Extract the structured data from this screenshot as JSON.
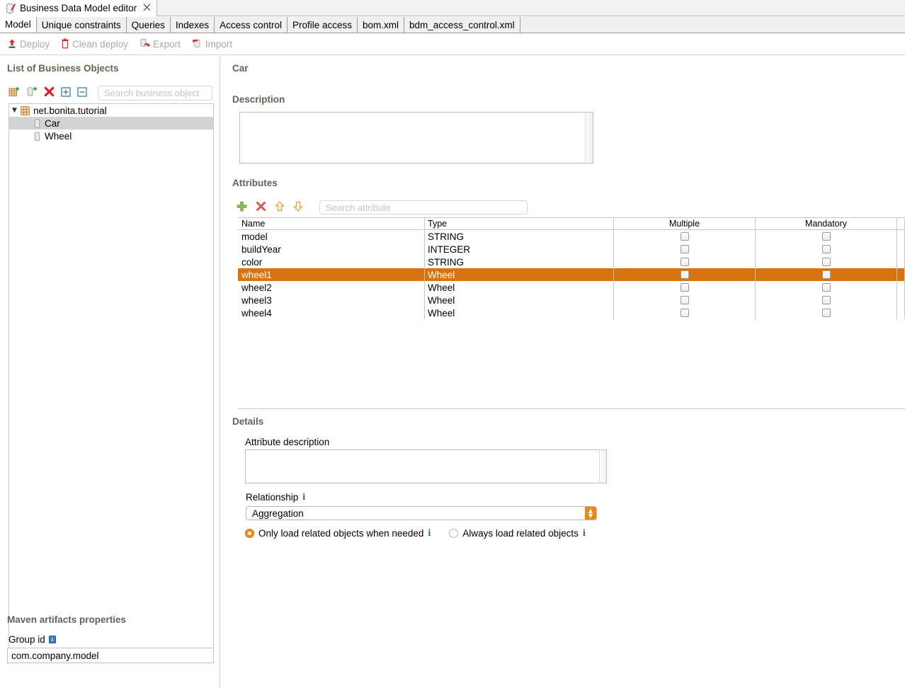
{
  "window": {
    "tab_title": "Business Data Model editor",
    "close_glyph": "✖"
  },
  "page_tabs": [
    {
      "label": "Model",
      "active": true
    },
    {
      "label": "Unique constraints",
      "active": false
    },
    {
      "label": "Queries",
      "active": false
    },
    {
      "label": "Indexes",
      "active": false
    },
    {
      "label": "Access control",
      "active": false
    },
    {
      "label": "Profile access",
      "active": false
    },
    {
      "label": "bom.xml",
      "active": false
    },
    {
      "label": "bdm_access_control.xml",
      "active": false
    }
  ],
  "toolbar": [
    {
      "label": "Deploy",
      "icon": "deploy-icon"
    },
    {
      "label": "Clean deploy",
      "icon": "trash-icon"
    },
    {
      "label": "Export",
      "icon": "export-icon"
    },
    {
      "label": "Import",
      "icon": "import-icon"
    }
  ],
  "sidebar": {
    "title": "List of Business Objects",
    "search_placeholder": "Search business object",
    "search_value": "",
    "actions": [
      {
        "name": "add-package-icon"
      },
      {
        "name": "add-business-object-icon"
      },
      {
        "name": "delete-icon"
      },
      {
        "name": "expand-all-icon"
      },
      {
        "name": "collapse-all-icon"
      }
    ],
    "tree": [
      {
        "label": "net.bonita.tutorial",
        "level": 0,
        "expanded": true,
        "selected": false,
        "icon": "package-icon"
      },
      {
        "label": "Car",
        "level": 1,
        "expanded": false,
        "selected": true,
        "icon": "object-icon"
      },
      {
        "label": "Wheel",
        "level": 1,
        "expanded": false,
        "selected": false,
        "icon": "object-icon"
      }
    ],
    "maven": {
      "title": "Maven artifacts properties",
      "group_id_label": "Group id",
      "group_id_value": "com.company.model"
    }
  },
  "main": {
    "object_name": "Car",
    "description_label": "Description",
    "description_value": "",
    "attributes_label": "Attributes",
    "attr_search_placeholder": "Search attribute",
    "attr_search_value": "",
    "attr_actions": [
      {
        "name": "add-attribute-icon"
      },
      {
        "name": "delete-attribute-icon"
      },
      {
        "name": "move-up-icon"
      },
      {
        "name": "move-down-icon"
      }
    ],
    "table": {
      "columns": [
        "Name",
        "Type",
        "Multiple",
        "Mandatory"
      ],
      "rows": [
        {
          "name": "model",
          "type": "STRING",
          "multiple": false,
          "mandatory": false,
          "selected": false
        },
        {
          "name": "buildYear",
          "type": "INTEGER",
          "multiple": false,
          "mandatory": false,
          "selected": false
        },
        {
          "name": "color",
          "type": "STRING",
          "multiple": false,
          "mandatory": false,
          "selected": false
        },
        {
          "name": "wheel1",
          "type": "Wheel",
          "multiple": false,
          "mandatory": false,
          "selected": true
        },
        {
          "name": "wheel2",
          "type": "Wheel",
          "multiple": false,
          "mandatory": false,
          "selected": false
        },
        {
          "name": "wheel3",
          "type": "Wheel",
          "multiple": false,
          "mandatory": false,
          "selected": false
        },
        {
          "name": "wheel4",
          "type": "Wheel",
          "multiple": false,
          "mandatory": false,
          "selected": false
        }
      ]
    },
    "details": {
      "label": "Details",
      "attribute_description_label": "Attribute description",
      "attribute_description_value": "",
      "relationship_label": "Relationship",
      "relationship_value": "Aggregation",
      "load_option_lazy": "Only load related objects when needed",
      "load_option_eager": "Always load related objects",
      "load_selected": "lazy"
    }
  },
  "colors": {
    "selection_orange": "#d9730d",
    "tree_selection_gray": "#d4d4d4",
    "section_title": "#6b5f55",
    "info_blue": "#1a5fb4"
  }
}
